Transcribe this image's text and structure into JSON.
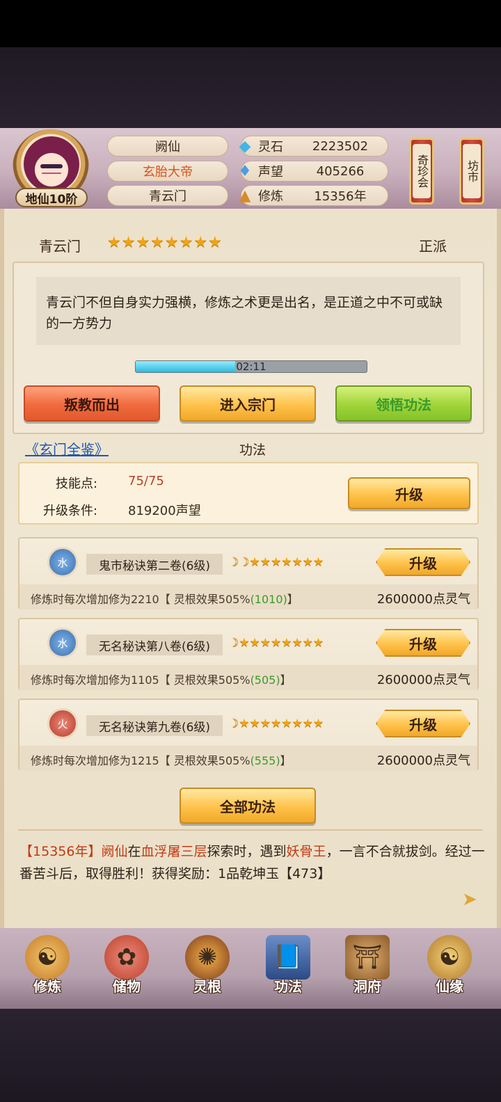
{
  "player": {
    "name": "阙仙",
    "title": "玄胎大帝",
    "sect": "青云门",
    "rank": "地仙10阶"
  },
  "resources": [
    {
      "icon": "spirit-stone-icon",
      "label": "灵石",
      "value": "2223502"
    },
    {
      "icon": "reputation-icon",
      "label": "声望",
      "value": "405266"
    },
    {
      "icon": "cultivation-icon",
      "label": "修炼",
      "value": "15356年"
    }
  ],
  "side_scrolls": {
    "treasure": "奇珍会",
    "market": "坊市"
  },
  "sect_panel": {
    "name": "青云门",
    "stars": "★★★★★★★★",
    "alignment": "正派",
    "description": "青云门不但自身实力强横，修炼之术更是出名，是正道之中不可或缺的一方势力",
    "timer": "02:11",
    "timer_progress": 0.43,
    "buttons": {
      "leave": "叛教而出",
      "enter": "进入宗门",
      "comprehend": "领悟功法"
    }
  },
  "skills_section": {
    "link": "《玄门全鉴》",
    "header": "功法",
    "skill_points_label": "技能点:",
    "skill_points_value": "75/75",
    "upgrade_condition_label": "升级条件:",
    "upgrade_condition_value": "819200声望",
    "upgrade_button": "升级"
  },
  "skills": [
    {
      "element": "水",
      "element_type": "water",
      "name": "鬼市秘诀第二卷(6级)",
      "stars": "☽☽★★★★★★★",
      "upgrade": "升级",
      "desc_prefix": "修炼时每次增加修为2210【 灵根效果505%",
      "desc_bonus": "(1010)",
      "desc_suffix": "】",
      "cost": "2600000点灵气"
    },
    {
      "element": "水",
      "element_type": "water",
      "name": "无名秘诀第八卷(6级)",
      "stars": "☽★★★★★★★★",
      "upgrade": "升级",
      "desc_prefix": "修炼时每次增加修为1105【 灵根效果505%",
      "desc_bonus": "(505)",
      "desc_suffix": "】",
      "cost": "2600000点灵气"
    },
    {
      "element": "火",
      "element_type": "fire",
      "name": "无名秘诀第九卷(6级)",
      "stars": "☽★★★★★★★★",
      "upgrade": "升级",
      "desc_prefix": "修炼时每次增加修为1215【 灵根效果505%",
      "desc_bonus": "(555)",
      "desc_suffix": "】",
      "cost": "2600000点灵气"
    }
  ],
  "all_skills_button": "全部功法",
  "log": {
    "p1": "【",
    "year": "15356年",
    "p2": "】",
    "name": "阙仙",
    "p3": "在",
    "place": "血浮屠三层",
    "p4": "探索时，遇到",
    "enemy": "妖骨王",
    "p5": "，一言不合就拔剑。经过一番苦斗后，取得胜利！获得奖励：1品乾坤玉【473】"
  },
  "nav": [
    {
      "label": "修炼",
      "icon": "cultivate-icon"
    },
    {
      "label": "储物",
      "icon": "storage-bag-icon"
    },
    {
      "label": "灵根",
      "icon": "spirit-root-icon"
    },
    {
      "label": "功法",
      "icon": "skill-book-icon"
    },
    {
      "label": "洞府",
      "icon": "cave-dwelling-icon"
    },
    {
      "label": "仙缘",
      "icon": "immortal-fate-icon"
    }
  ],
  "colors": {
    "accent_orange": "#d6551c",
    "red_text": "#c23a14",
    "green_text": "#3a9a2a",
    "link_blue": "#1d57b0",
    "star_gold": "#f0a415"
  }
}
